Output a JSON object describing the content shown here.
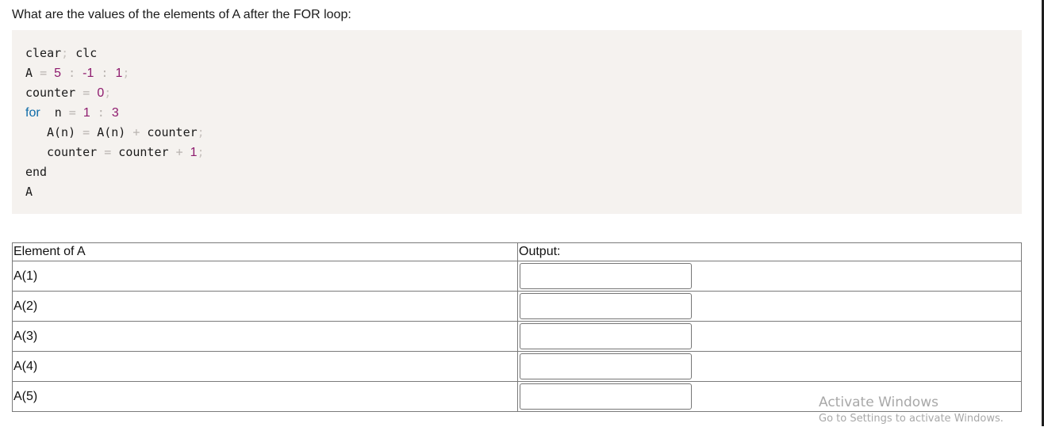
{
  "question": "What are the values of the elements of A after the FOR loop:",
  "code": {
    "line1": {
      "a": "clear",
      "semi": ";",
      "b": " clc"
    },
    "line2": {
      "var": "A ",
      "eq": "=",
      "n1": "5",
      "c1": ":",
      "n2": "-1",
      "c2": ":",
      "n3": "1",
      "semi": ";"
    },
    "line3": {
      "var": "counter ",
      "eq": "=",
      "n1": "0",
      "semi": ";"
    },
    "line4": {
      "kw": "for",
      "var": "  n ",
      "eq": "=",
      "n1": "1",
      "c1": ":",
      "n2": "3"
    },
    "line5": {
      "a": "A(n) ",
      "eq": "=",
      "b": " A(n) ",
      "plus": "+",
      "c": " counter",
      "semi": ";"
    },
    "line6": {
      "a": "counter ",
      "eq": "=",
      "b": " counter ",
      "plus": "+",
      "n1": "1",
      "semi": ";"
    },
    "line7": {
      "kw": "end"
    },
    "line8": {
      "a": "A"
    }
  },
  "table": {
    "headers": [
      "Element of A",
      "Output:"
    ],
    "rows": [
      {
        "element": "A(1)",
        "value": ""
      },
      {
        "element": "A(2)",
        "value": ""
      },
      {
        "element": "A(3)",
        "value": ""
      },
      {
        "element": "A(4)",
        "value": ""
      },
      {
        "element": "A(5)",
        "value": ""
      }
    ]
  },
  "watermark": {
    "title": "Activate Windows",
    "subtitle": "Go to Settings to activate Windows."
  }
}
